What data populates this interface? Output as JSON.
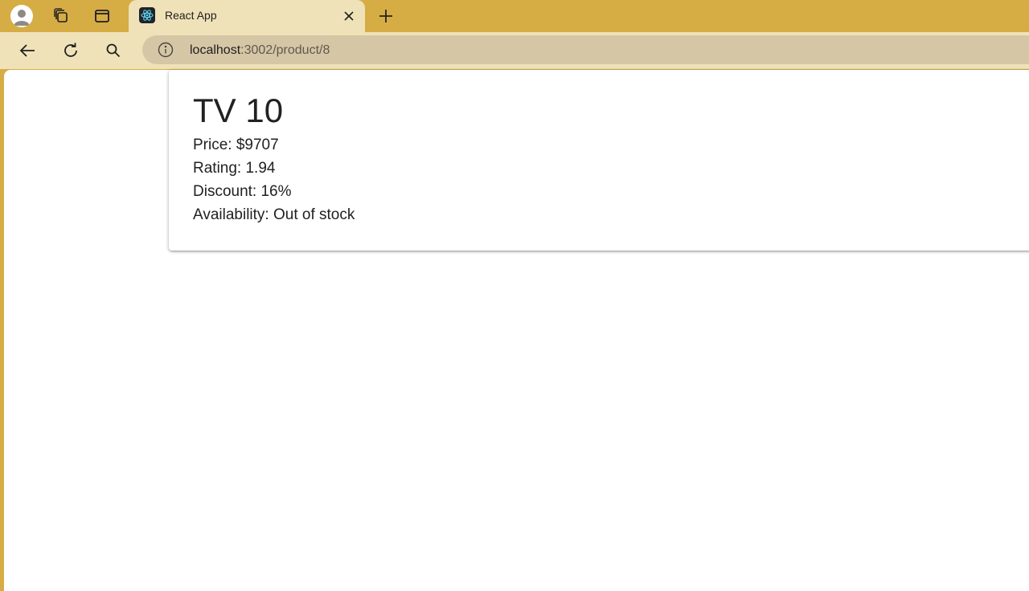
{
  "browser": {
    "tab": {
      "title": "React App",
      "favicon": "react-logo-icon"
    },
    "toolbar": {
      "back_icon": "back-arrow-icon",
      "reload_icon": "reload-icon",
      "search_icon": "search-icon"
    },
    "address": {
      "host": "localhost",
      "path": ":3002/product/8",
      "info_icon": "info-icon"
    },
    "colors": {
      "frame": "#d6ac45",
      "tab_active": "#f0e2b8",
      "omnibox": "#d5c6a5"
    }
  },
  "product": {
    "title": "TV 10",
    "price": "Price: $9707",
    "rating": "Rating: 1.94",
    "discount": "Discount: 16%",
    "availability": "Availability: Out of stock"
  }
}
